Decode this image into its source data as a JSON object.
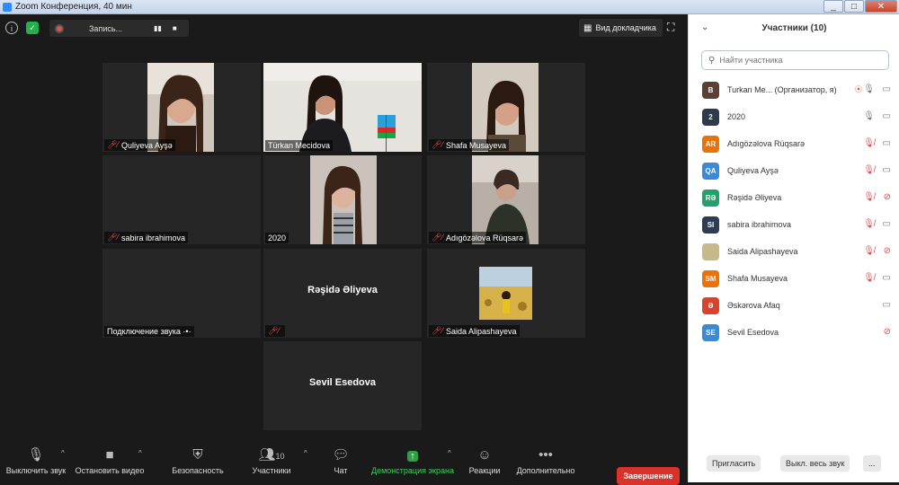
{
  "window": {
    "title": "Zoom Конференция, 40 мин",
    "minimize": "_",
    "maximize": "□",
    "close": "✕"
  },
  "topbar": {
    "recording_label": "Запись...",
    "pause_glyph": "▮▮",
    "stop_glyph": "■",
    "speaker_view_label": "Вид докладчика",
    "info_glyph": "i",
    "shield_glyph": "✓",
    "fullscreen_glyph": "⛶"
  },
  "tiles": [
    {
      "name": "Quliyeva Ayşə",
      "muted": true
    },
    {
      "name": "Türkan Mecidova",
      "muted": false,
      "active": true
    },
    {
      "name": "Shafa Musayeva",
      "muted": true
    },
    {
      "name": "sabira ibrahimova",
      "muted": true
    },
    {
      "name": "2020",
      "muted": false
    },
    {
      "name": "Adıgözəlova Rüqsarə",
      "muted": true
    },
    {
      "name": "Подключение звука ·•·",
      "muted": false
    },
    {
      "center": "Rəşidə Əliyeva",
      "muted": true
    },
    {
      "name": "Saida Alipashayeva",
      "muted": true
    },
    {
      "center": "Sevil Esedova"
    }
  ],
  "toolbar": {
    "mute_label": "Выключить звук",
    "video_label": "Остановить видео",
    "security_label": "Безопасность",
    "participants_label": "Участники",
    "participants_count": "10",
    "chat_label": "Чат",
    "share_label": "Демонстрация экрана",
    "reactions_label": "Реакции",
    "more_label": "Дополнительно",
    "end_label": "Завершение",
    "caret": "^"
  },
  "panel": {
    "title": "Участники (10)",
    "chevron": "⌄",
    "search_placeholder": "Найти участника",
    "participants": [
      {
        "initials": "B",
        "name": "Turkan Me...  (Организатор, я)",
        "color": "#5c4033",
        "mic": "on",
        "cam": "on",
        "recording": true
      },
      {
        "initials": "2",
        "name": "2020",
        "color": "#2f3a4d",
        "mic": "on",
        "cam": "on"
      },
      {
        "initials": "AR",
        "name": "Adıgözəlova Rüqsarə",
        "color": "#e8730c",
        "mic": "muted",
        "cam": "on"
      },
      {
        "initials": "QA",
        "name": "Quliyeva Ayşə",
        "color": "#3a8ad6",
        "mic": "muted",
        "cam": "on"
      },
      {
        "initials": "RƏ",
        "name": "Rəşidə Əliyeva",
        "color": "#26a06b",
        "mic": "muted",
        "cam": "off"
      },
      {
        "initials": "SI",
        "name": "sabira ibrahimova",
        "color": "#2d3b55",
        "mic": "muted",
        "cam": "on"
      },
      {
        "initials": "",
        "name": "Saida Alipashayeva",
        "color": "#c8b98a",
        "mic": "muted",
        "cam": "off"
      },
      {
        "initials": "SM",
        "name": "Shafa Musayeva",
        "color": "#e8730c",
        "mic": "muted",
        "cam": "on"
      },
      {
        "initials": "Ə",
        "name": "Əskərova Afaq",
        "color": "#d9432b",
        "mic": "none",
        "cam": "on"
      },
      {
        "initials": "SE",
        "name": "Sevil Esedova",
        "color": "#3a8ad6",
        "mic": "none",
        "cam": "off"
      }
    ],
    "invite_label": "Пригласить",
    "mute_all_label": "Выкл. весь звук",
    "more_label": "..."
  },
  "colors": {
    "accent_active": "#c8e04a",
    "end_red": "#d9322b",
    "share_green": "#2ea043"
  }
}
